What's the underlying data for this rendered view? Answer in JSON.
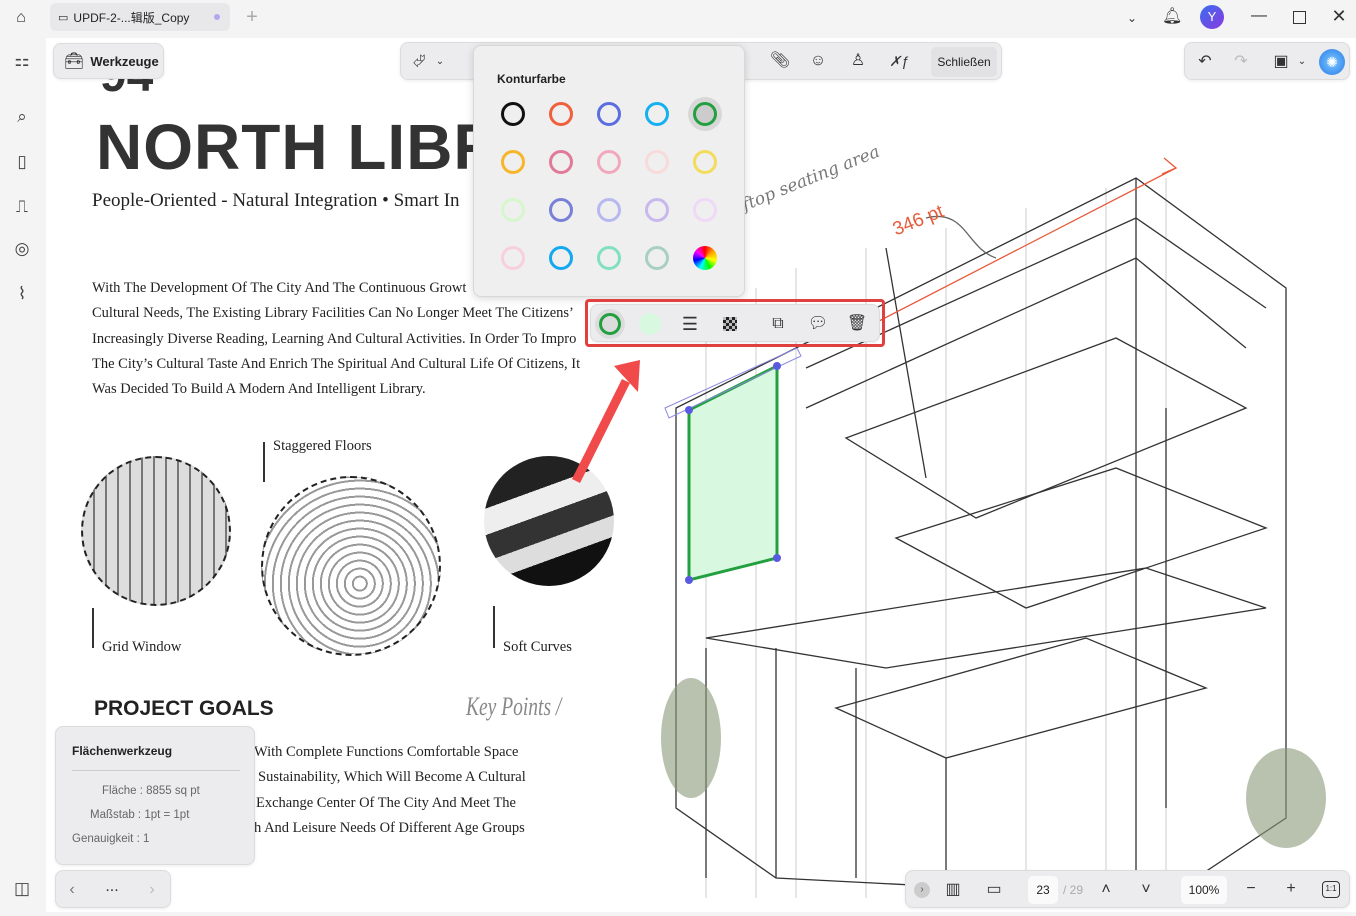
{
  "tabbar": {
    "tab_title": "UPDF-2-...辑版_Copy",
    "avatar_letter": "Y"
  },
  "toolbar": {
    "tools_label": "Werkzeuge",
    "close_label": "Schließen"
  },
  "document": {
    "page_number_partial": "94",
    "title": "NORTH LIBR",
    "subtitle": "People-Oriented - Natural Integration • Smart In",
    "paragraph": [
      "With The Development Of The City And The Continuous Growt",
      "Cultural Needs, The Existing Library Facilities Can No Longer Meet The Citizens’",
      "Increasingly Diverse Reading, Learning And Cultural Activities. In Order To Impro",
      "The City’s Cultural Taste And Enrich The Spiritual And Cultural Life Of Citizens, It",
      "Was Decided To Build A Modern And Intelligent Library."
    ],
    "labels": {
      "staggered": "Staggered Floors",
      "grid": "Grid Window",
      "soft": "Soft Curves"
    },
    "goals_title": "PROJECT GOALS",
    "key_points": "Key Points /",
    "goals_text": [
      "With Complete Functions Comfortable Space",
      "Sustainability, Which Will Become A Cultural",
      "Exchange Center Of The City And Meet The",
      "h And Leisure Needs Of Different Age Groups"
    ],
    "annotation_text": "ftop seating area",
    "measure_label": "346 pt"
  },
  "color_popup": {
    "title": "Konturfarbe",
    "colors": [
      "#111111",
      "#f0603c",
      "#5a6ee0",
      "#14b0f0",
      "#22a040",
      "#f7b52a",
      "#e07a98",
      "#f2a8bc",
      "#f8dada",
      "#f2dc5a",
      "#d6f6cc",
      "#7880d8",
      "#b8b8f0",
      "#c8b8ec",
      "#f0d8f8",
      "#f8d0dc",
      "#14a8f0",
      "#80e0c0",
      "#a8d0c0",
      "rainbow"
    ],
    "selected": "#22a040"
  },
  "shape_toolbar": {
    "stroke_color": "#22a040",
    "fill_color": "#d8f8e0",
    "highlight": "#e04040"
  },
  "area_panel": {
    "title": "Flächenwerkzeug",
    "area": "Fläche : 8855 sq pt",
    "scale": "Maßstab : 1pt = 1pt",
    "precision": "Genauigkeit : 1"
  },
  "pager": {
    "more": "..."
  },
  "bottom": {
    "current_page": "23",
    "total_pages": "/ 29",
    "zoom": "100%",
    "fit": "1:1"
  }
}
